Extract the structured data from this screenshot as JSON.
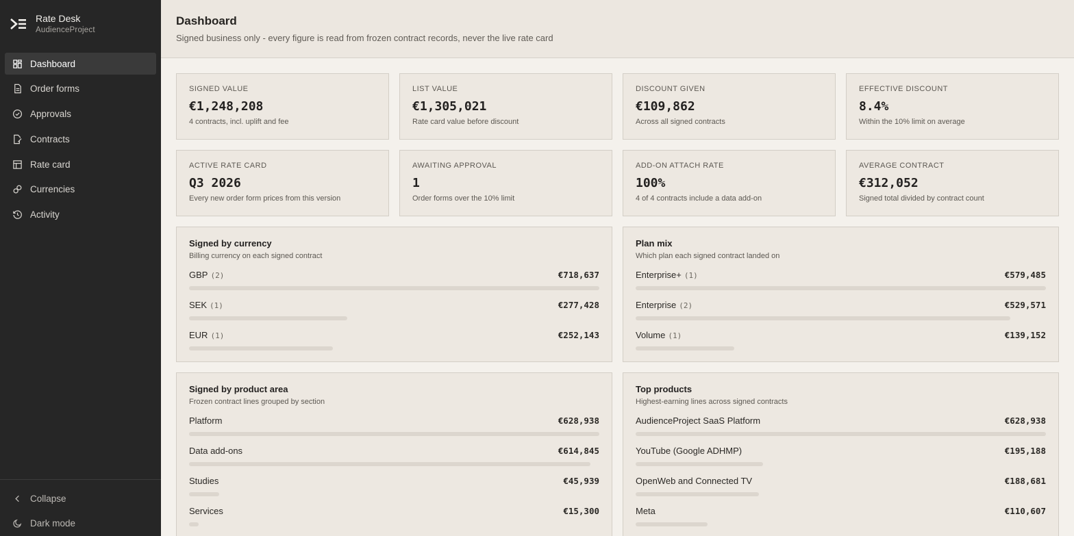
{
  "brand": {
    "name": "Rate Desk",
    "subtitle": "AudienceProject"
  },
  "nav": [
    {
      "label": "Dashboard",
      "icon": "grid-icon",
      "active": true
    },
    {
      "label": "Order forms",
      "icon": "document-icon"
    },
    {
      "label": "Approvals",
      "icon": "check-circle-icon"
    },
    {
      "label": "Contracts",
      "icon": "contract-icon"
    },
    {
      "label": "Rate card",
      "icon": "table-icon"
    },
    {
      "label": "Currencies",
      "icon": "link-icon"
    },
    {
      "label": "Activity",
      "icon": "history-icon"
    }
  ],
  "footer_nav": {
    "collapse": "Collapse",
    "dark_mode": "Dark mode"
  },
  "header": {
    "title": "Dashboard",
    "subtitle": "Signed business only - every figure is read from frozen contract records, never the live rate card"
  },
  "stats": [
    {
      "label": "SIGNED VALUE",
      "value": "€1,248,208",
      "note": "4 contracts, incl. uplift and fee"
    },
    {
      "label": "LIST VALUE",
      "value": "€1,305,021",
      "note": "Rate card value before discount"
    },
    {
      "label": "DISCOUNT GIVEN",
      "value": "€109,862",
      "note": "Across all signed contracts"
    },
    {
      "label": "EFFECTIVE DISCOUNT",
      "value": "8.4%",
      "note": "Within the 10% limit on average"
    },
    {
      "label": "ACTIVE RATE CARD",
      "value": "Q3 2026",
      "note": "Every new order form prices from this version"
    },
    {
      "label": "AWAITING APPROVAL",
      "value": "1",
      "note": "Order forms over the 10% limit"
    },
    {
      "label": "ADD-ON ATTACH RATE",
      "value": "100%",
      "note": "4 of 4 contracts include a data add-on"
    },
    {
      "label": "AVERAGE CONTRACT",
      "value": "€312,052",
      "note": "Signed total divided by contract count"
    }
  ],
  "panels": {
    "currency": {
      "title": "Signed by currency",
      "subtitle": "Billing currency on each signed contract",
      "rows": [
        {
          "label": "GBP",
          "count": "(2)",
          "value": "€718,637",
          "fraction": 1.0
        },
        {
          "label": "SEK",
          "count": "(1)",
          "value": "€277,428",
          "fraction": 0.386
        },
        {
          "label": "EUR",
          "count": "(1)",
          "value": "€252,143",
          "fraction": 0.351
        }
      ]
    },
    "plan": {
      "title": "Plan mix",
      "subtitle": "Which plan each signed contract landed on",
      "rows": [
        {
          "label": "Enterprise+",
          "count": "(1)",
          "value": "€579,485",
          "fraction": 1.0
        },
        {
          "label": "Enterprise",
          "count": "(2)",
          "value": "€529,571",
          "fraction": 0.914
        },
        {
          "label": "Volume",
          "count": "(1)",
          "value": "€139,152",
          "fraction": 0.24
        }
      ]
    },
    "product_area": {
      "title": "Signed by product area",
      "subtitle": "Frozen contract lines grouped by section",
      "rows": [
        {
          "label": "Platform",
          "value": "€628,938",
          "fraction": 1.0
        },
        {
          "label": "Data add-ons",
          "value": "€614,845",
          "fraction": 0.978
        },
        {
          "label": "Studies",
          "value": "€45,939",
          "fraction": 0.073
        },
        {
          "label": "Services",
          "value": "€15,300",
          "fraction": 0.024
        }
      ]
    },
    "top_products": {
      "title": "Top products",
      "subtitle": "Highest-earning lines across signed contracts",
      "rows": [
        {
          "label": "AudienceProject SaaS Platform",
          "value": "€628,938",
          "fraction": 1.0
        },
        {
          "label": "YouTube (Google ADHMP)",
          "value": "€195,188",
          "fraction": 0.31
        },
        {
          "label": "OpenWeb and Connected TV",
          "value": "€188,681",
          "fraction": 0.3
        },
        {
          "label": "Meta",
          "value": "€110,607",
          "fraction": 0.176
        }
      ]
    }
  },
  "colors": {
    "sidebar": "#262626",
    "background": "#f4f1ec",
    "card": "#ede8e1",
    "bar": "#dcd6ce"
  }
}
